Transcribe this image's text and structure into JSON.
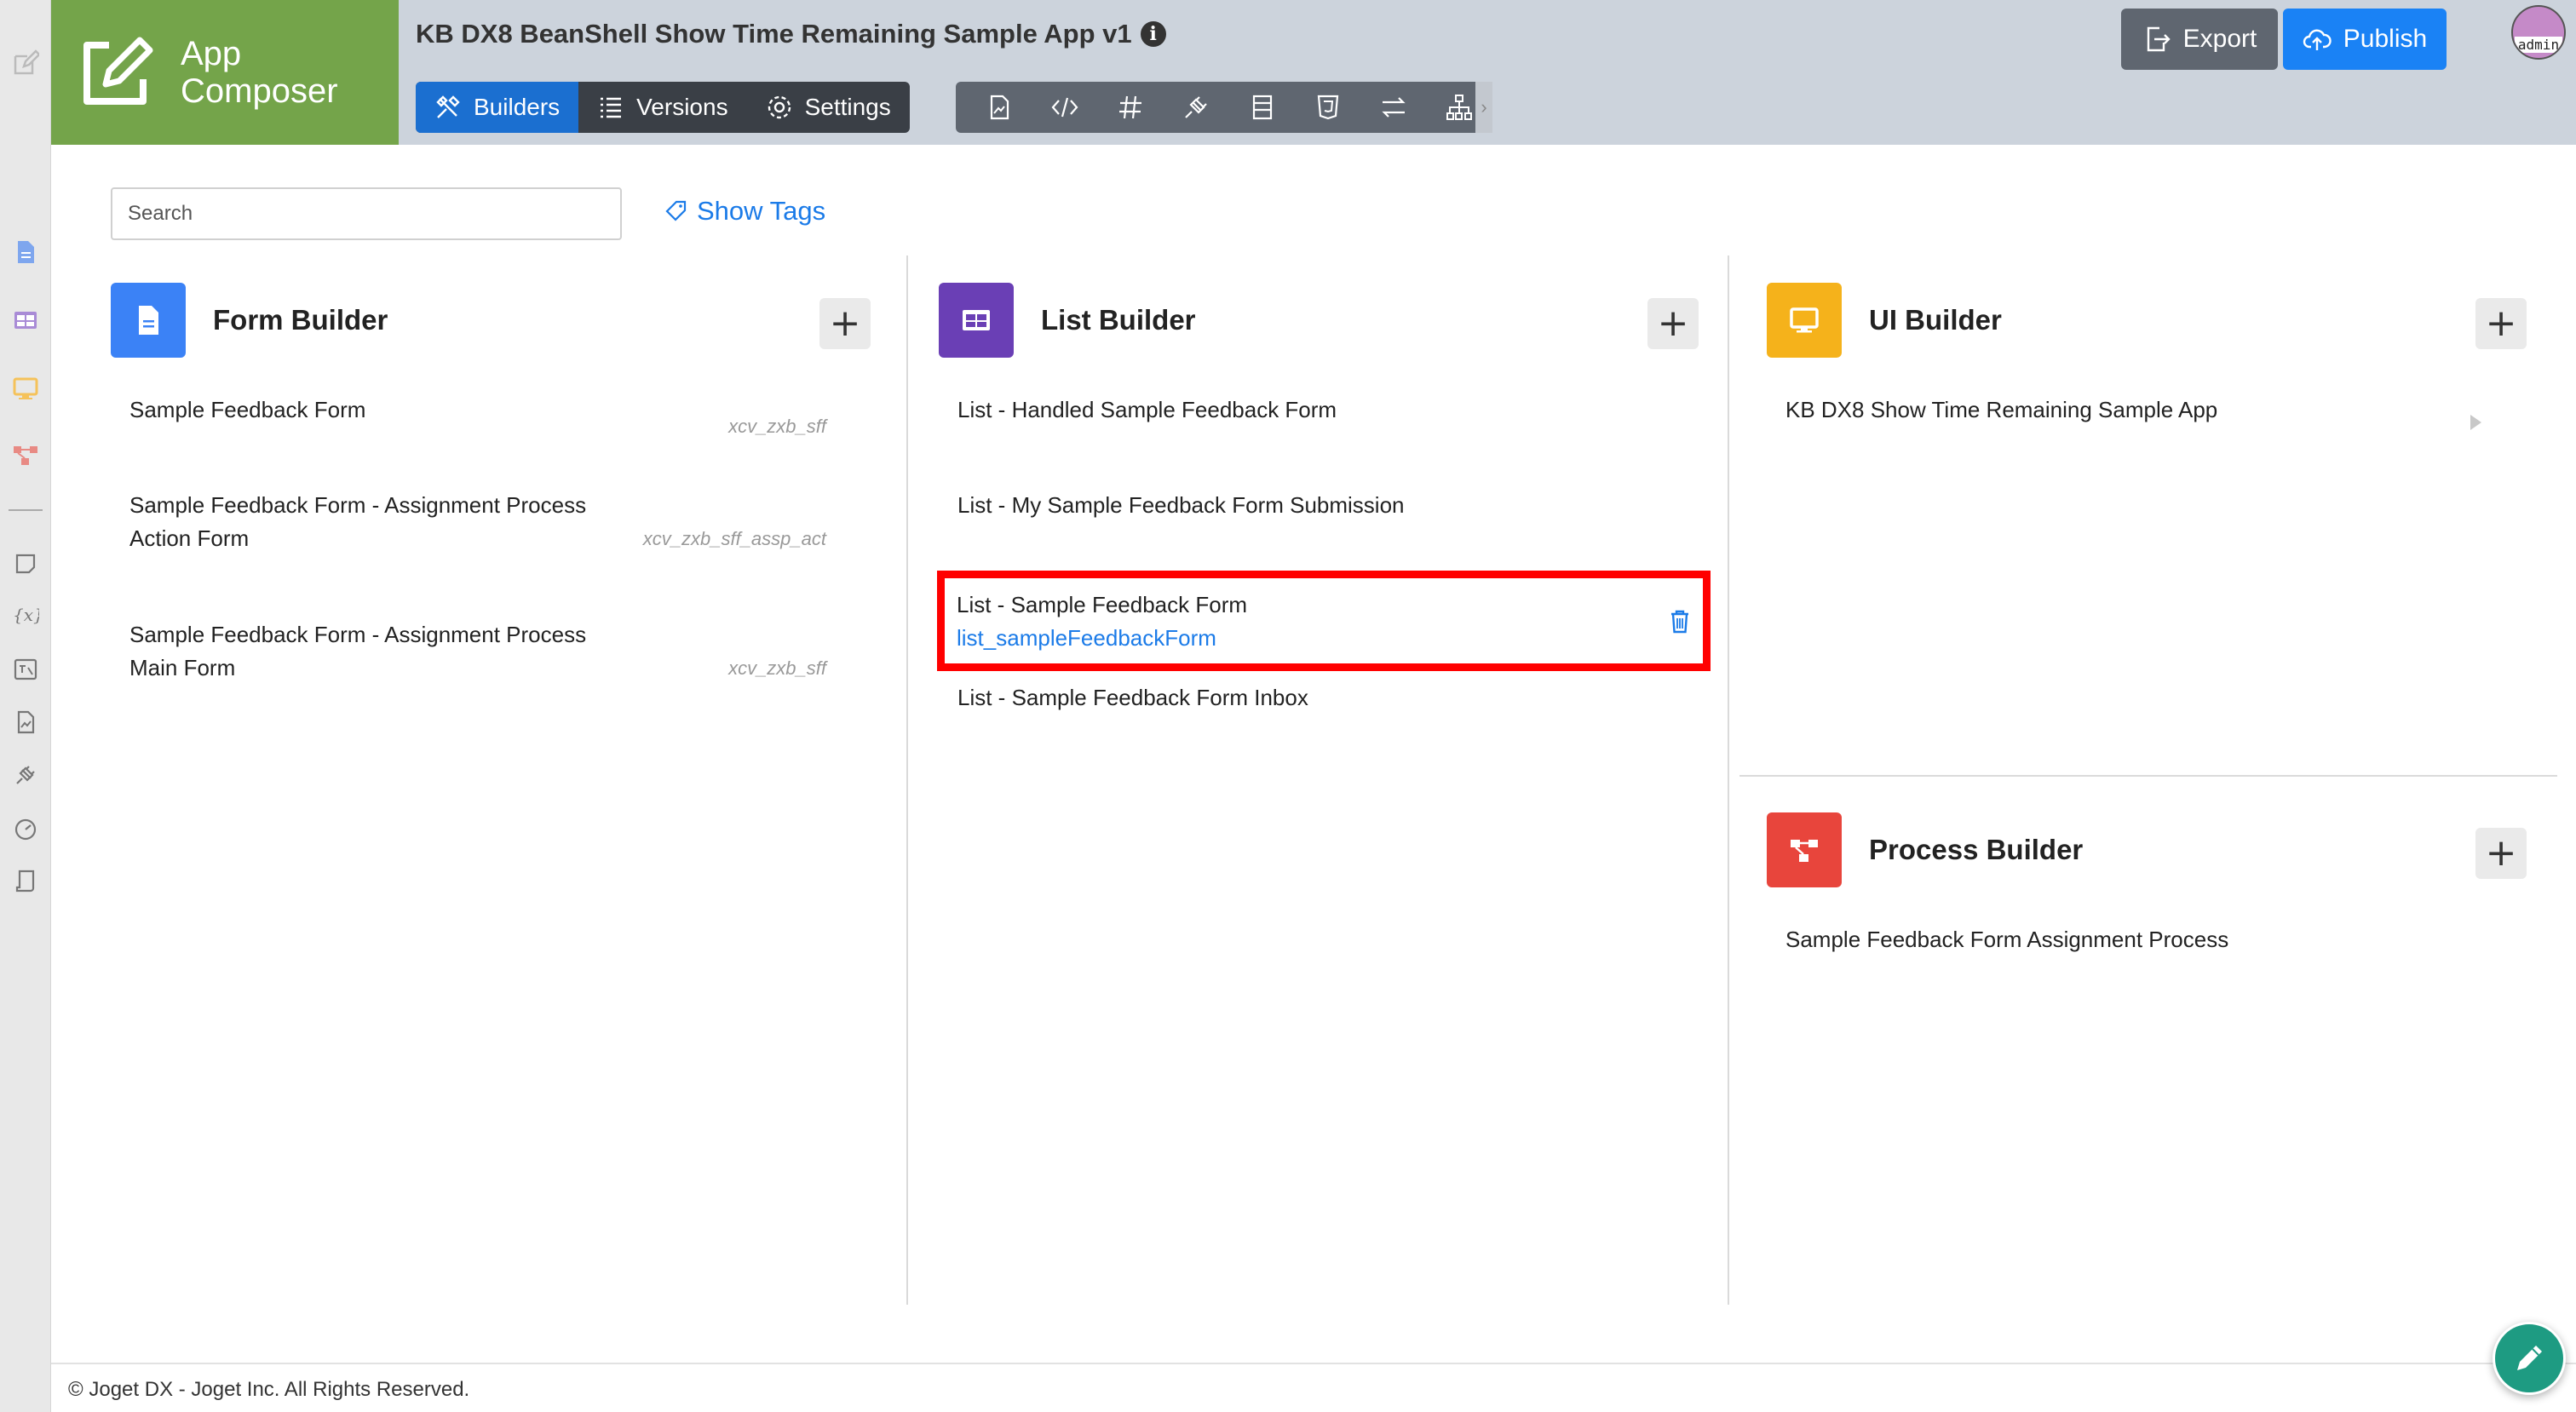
{
  "header": {
    "logo_line1": "App",
    "logo_line2": "Composer",
    "app_title": "KB DX8 BeanShell Show Time Remaining Sample App v1",
    "info_glyph": "i",
    "tabs": [
      {
        "label": "Builders",
        "icon": "tools-icon",
        "active": true
      },
      {
        "label": "Versions",
        "icon": "list-icon",
        "active": false
      },
      {
        "label": "Settings",
        "icon": "gear-icon",
        "active": false
      }
    ],
    "toolbar_icons": [
      "page-icon",
      "code-icon",
      "hash-icon",
      "plug-icon",
      "table-icon",
      "html5-icon",
      "transfer-icon",
      "sitemap-icon"
    ],
    "export_label": "Export",
    "publish_label": "Publish",
    "avatar_label": "admin"
  },
  "search": {
    "placeholder": "Search",
    "value": ""
  },
  "show_tags_label": "Show Tags",
  "form_builder": {
    "title": "Form Builder",
    "icon_color": "#3b82f6",
    "items": [
      {
        "line1": "Sample Feedback Form",
        "line2": "",
        "id": "xcv_zxb_sff"
      },
      {
        "line1": "Sample Feedback Form - Assignment Process",
        "line2": "Action Form",
        "id": "xcv_zxb_sff_assp_act"
      },
      {
        "line1": "Sample Feedback Form - Assignment Process",
        "line2": "Main Form",
        "id": "xcv_zxb_sff"
      }
    ]
  },
  "list_builder": {
    "title": "List Builder",
    "icon_color": "#6a3fb5",
    "items": [
      {
        "name": "List - Handled Sample Feedback Form"
      },
      {
        "name": "List - My Sample Feedback Form Submission"
      },
      {
        "name": "List - Sample Feedback Form",
        "id": "list_sampleFeedbackForm",
        "highlighted": true
      },
      {
        "name": "List - Sample Feedback Form Inbox"
      }
    ]
  },
  "ui_builder": {
    "title": "UI Builder",
    "icon_color": "#f5b21b",
    "items": [
      {
        "name": "KB DX8 Show Time Remaining Sample App"
      }
    ]
  },
  "process_builder": {
    "title": "Process Builder",
    "icon_color": "#e8453c",
    "items": [
      {
        "name": "Sample Feedback Form Assignment Process"
      }
    ]
  },
  "footer": {
    "text": "© Joget DX - Joget Inc. All Rights Reserved."
  },
  "add_glyph": "+",
  "colors": {
    "logo_green": "#74a44a",
    "accent_blue": "#1b6fd0",
    "publish_blue": "#1a82f5",
    "highlight_red": "#ff0000",
    "fab_green": "#1e9b82"
  }
}
